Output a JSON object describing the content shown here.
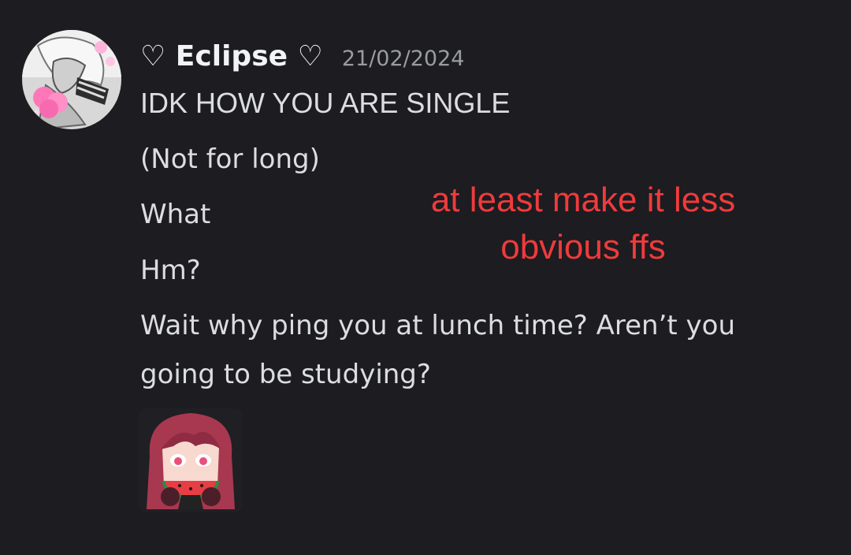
{
  "author": {
    "name": "♡ Eclipse ♡",
    "timestamp": "21/02/2024",
    "avatar_icon": "anime-avatar-with-pink-hearts"
  },
  "messages": [
    "IDK HOW YOU ARE SINGLE",
    "(Not for long)",
    "What",
    "Hm?",
    "Wait why ping you at lunch time? Aren’t you going to be studying?"
  ],
  "annotation": {
    "text": "at least make it less obvious ffs",
    "color": "#ef3b3b"
  },
  "sticker": {
    "icon": "anime-girl-eating-watermelon-sticker"
  },
  "colors": {
    "background": "#1c1c21",
    "username": "#f2f3f5",
    "message_text": "#dcdde1",
    "timestamp": "#9a9ca3"
  }
}
